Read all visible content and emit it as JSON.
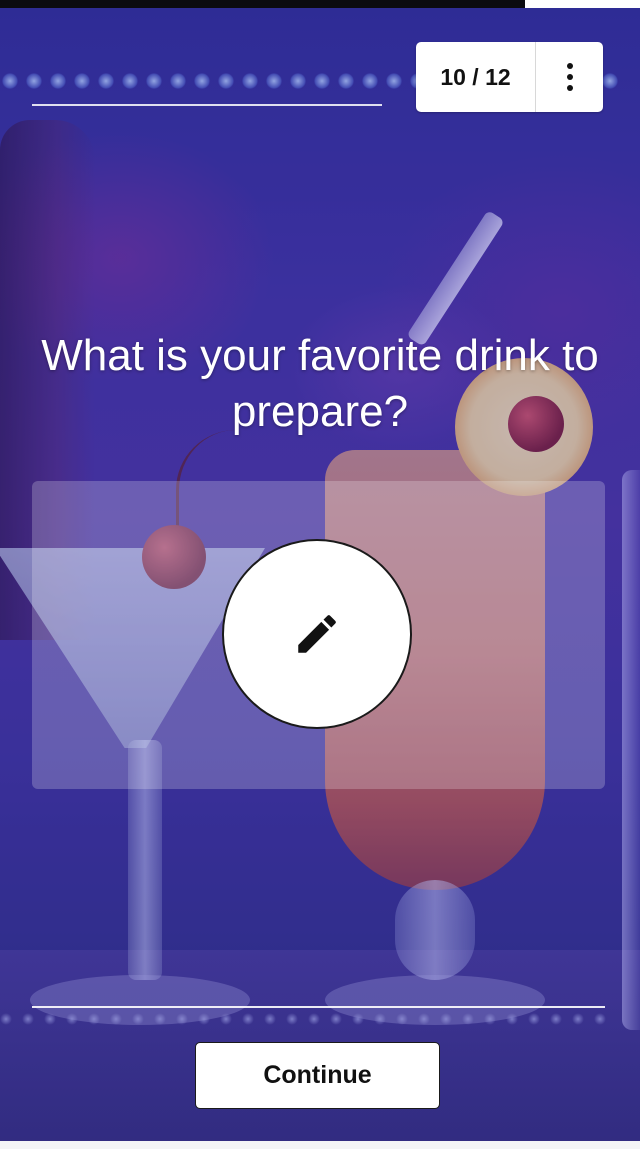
{
  "progress": {
    "counter_label": "10 / 12",
    "current": 10,
    "total": 12
  },
  "question": {
    "text": "What is your favorite drink to prepare?"
  },
  "answer": {
    "edit_icon": "pencil-icon"
  },
  "footer": {
    "continue_label": "Continue"
  },
  "menu": {
    "icon": "more-vertical-icon"
  },
  "colors": {
    "background_tint": "#3b2f9a",
    "button_bg": "#ffffff",
    "text_on_dark": "#ffffff"
  }
}
